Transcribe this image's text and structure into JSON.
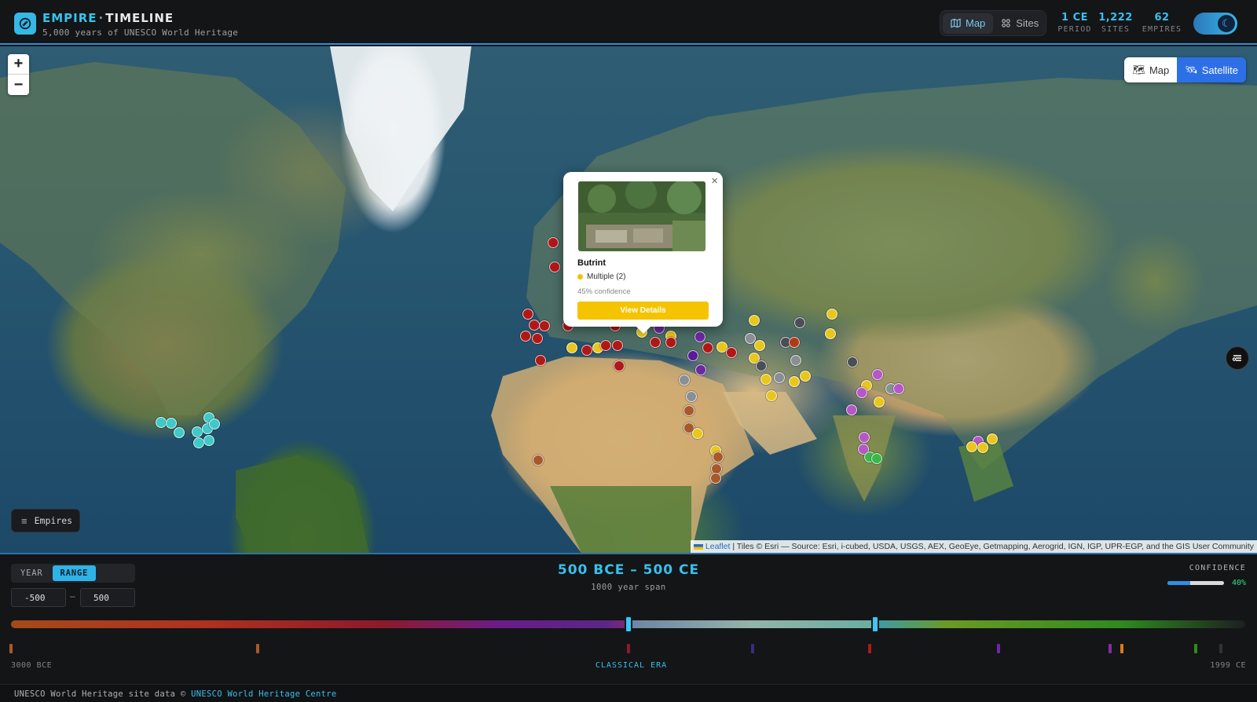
{
  "header": {
    "brand_a": "EMPIRE",
    "brand_sep": "·",
    "brand_b": "TIMELINE",
    "subtitle": "5,000 years of UNESCO World Heritage",
    "view_map": "Map",
    "view_sites": "Sites",
    "stats": [
      {
        "value": "1 CE",
        "label": "PERIOD"
      },
      {
        "value": "1,222",
        "label": "SITES"
      },
      {
        "value": "62",
        "label": "EMPIRES"
      }
    ]
  },
  "map": {
    "layer_map": "Map",
    "layer_satellite": "Satellite",
    "empires_button": "Empires",
    "attribution_leaflet": "Leaflet",
    "attribution_rest": " | Tiles © Esri — Source: Esri, i-cubed, USDA, USGS, AEX, GeoEye, Getmapping, Aerogrid, IGN, IGP, UPR-EGP, and the GIS User Community"
  },
  "popup": {
    "site_name": "Butrint",
    "empire": "Multiple (2)",
    "confidence": "45% confidence",
    "button": "View Details"
  },
  "timeline": {
    "mode_year": "YEAR",
    "mode_range": "RANGE",
    "start_value": "-500",
    "end_value": "500",
    "range_sep": "–",
    "range_title": "500 BCE – 500 CE",
    "span": "1000 year span",
    "confidence_label": "CONFIDENCE",
    "confidence_percent": "40%",
    "confidence_value": 0.4,
    "axis_start": "3000 BCE",
    "axis_end": "1999 CE",
    "era_label": "CLASSICAL ERA"
  },
  "footer": {
    "text": "UNESCO World Heritage site data © ",
    "link": "UNESCO World Heritage Centre"
  },
  "colors": {
    "accent": "#36c0ee",
    "satellite_active": "#2d6fe6",
    "popup_button": "#f5c400"
  }
}
